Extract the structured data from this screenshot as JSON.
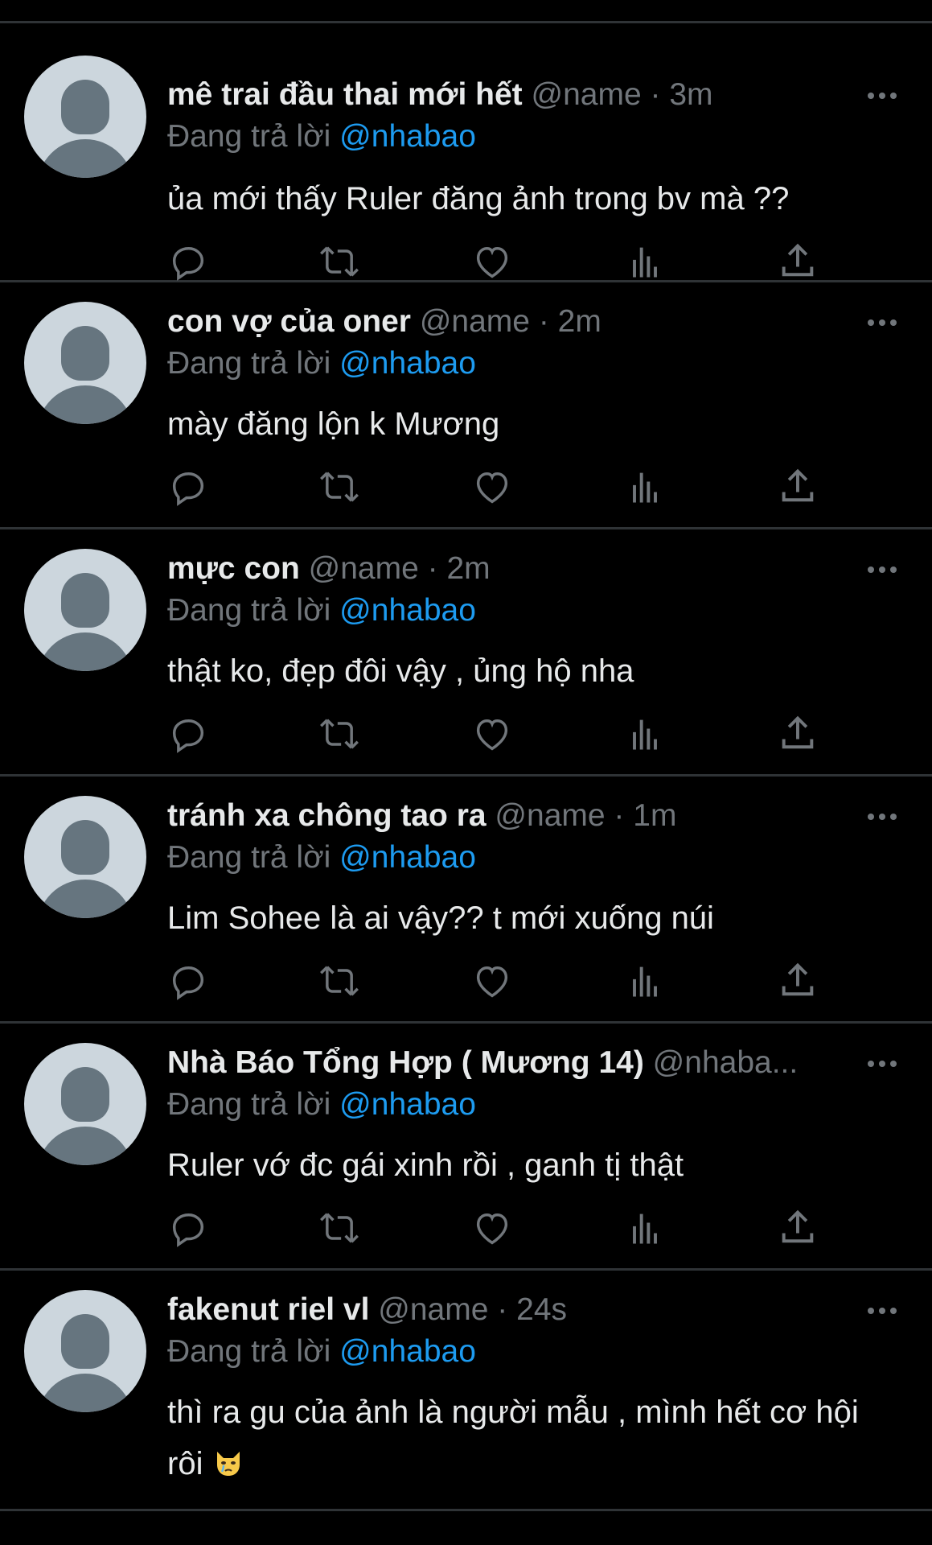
{
  "colors": {
    "background": "#000000",
    "divider": "#2f3336",
    "primary_text": "#e7e9ea",
    "secondary_text": "#71767b",
    "link": "#1d9bf0",
    "avatar_bg": "#ccd6dd",
    "avatar_fg": "#66757f"
  },
  "icons": {
    "reply": "reply-icon",
    "retweet": "retweet-icon",
    "like": "heart-icon",
    "views": "views-chart-icon",
    "share": "share-icon",
    "more": "more-dots-icon",
    "emoji": "crying-cat-emoji"
  },
  "tweets": [
    {
      "display_name": "mê trai đầu thai mới hết",
      "handle": "@name",
      "dot": "·",
      "time": "3m",
      "reply_prefix": "Đang trả lời",
      "reply_target": "@nhabao",
      "text": "ủa mới thấy Ruler đăng ảnh trong bv mà ??"
    },
    {
      "display_name": "con vợ của oner",
      "handle": "@name",
      "dot": "·",
      "time": "2m",
      "reply_prefix": "Đang trả lời",
      "reply_target": "@nhabao",
      "text": "mày đăng lộn k Mương"
    },
    {
      "display_name": "mực con",
      "handle": "@name",
      "dot": "·",
      "time": "2m",
      "reply_prefix": "Đang trả lời",
      "reply_target": "@nhabao",
      "text": "thật ko, đẹp đôi vậy , ủng hộ nha"
    },
    {
      "display_name": "tránh xa chông tao ra",
      "handle": "@name",
      "dot": "·",
      "time": "1m",
      "reply_prefix": "Đang trả lời",
      "reply_target": "@nhabao",
      "text": "Lim Sohee là ai vậy?? t mới xuống núi"
    },
    {
      "display_name": "Nhà Báo Tổng Hợp ( Mương 14)",
      "handle": "@nhaba...",
      "dot": "",
      "time": "",
      "reply_prefix": "Đang trả lời",
      "reply_target": "@nhabao",
      "text": "Ruler vớ đc gái xinh rồi , ganh tị thật"
    },
    {
      "display_name": "fakenut riel vl",
      "handle": "@name",
      "dot": "·",
      "time": "24s",
      "reply_prefix": "Đang trả lời",
      "reply_target": "@nhabao",
      "text": "thì ra gu của ảnh là người mẫu , mình hết cơ hội rôi"
    }
  ]
}
